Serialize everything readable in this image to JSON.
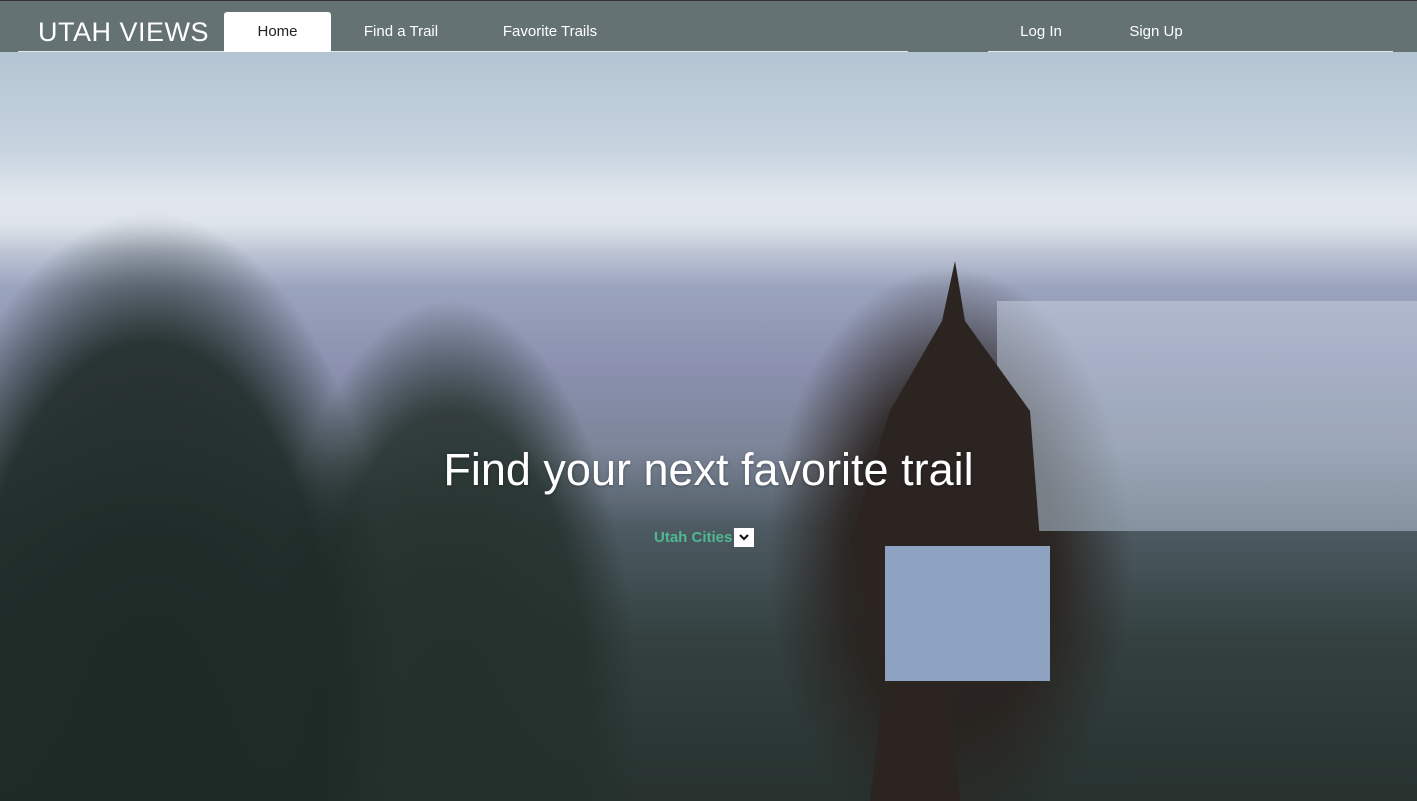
{
  "nav": {
    "logo": "UTAH VIEWS",
    "tabs": [
      {
        "label": "Home",
        "active": true
      },
      {
        "label": "Find a Trail"
      },
      {
        "label": "Favorite Trails"
      }
    ],
    "auth": [
      {
        "label": "Log In"
      },
      {
        "label": "Sign Up"
      }
    ]
  },
  "hero": {
    "title": "Find your next favorite trail",
    "dropdown": {
      "selected": "Utah Cities",
      "icon": "chevron-down-icon"
    }
  },
  "colors": {
    "nav_bg": "#647274",
    "accent": "#4fb893"
  }
}
